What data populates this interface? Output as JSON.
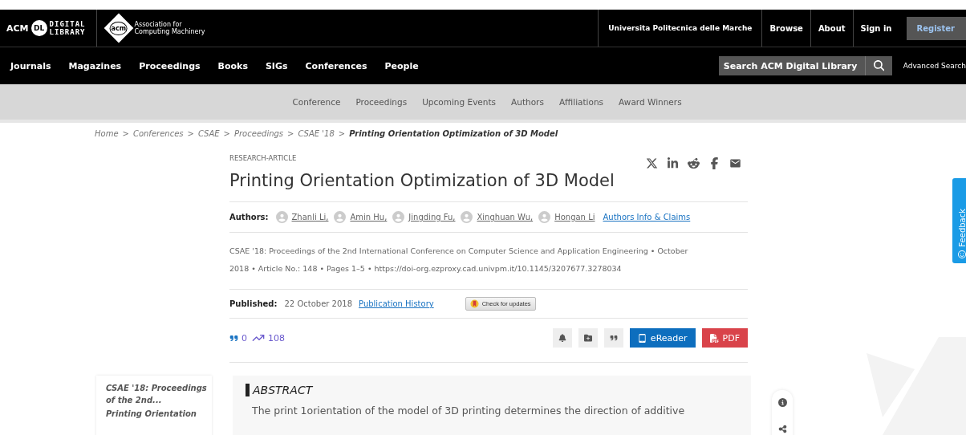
{
  "header": {
    "logo": {
      "acm": "ACM",
      "dl": "DL",
      "line1": "DIGITAL",
      "line2": "LIBRARY"
    },
    "org_logo": {
      "mark": "acm",
      "line1": "Association for",
      "line2": "Computing Machinery"
    },
    "institution": "Universita Politecnica delle Marche",
    "links": [
      "Browse",
      "About",
      "Sign in"
    ],
    "register": "Register"
  },
  "nav": {
    "items": [
      "Journals",
      "Magazines",
      "Proceedings",
      "Books",
      "SIGs",
      "Conferences",
      "People"
    ],
    "search": {
      "placeholder": "Search ACM Digital Library"
    },
    "advanced": "Advanced Search"
  },
  "subnav": [
    "Conference",
    "Proceedings",
    "Upcoming Events",
    "Authors",
    "Affiliations",
    "Award Winners"
  ],
  "breadcrumb": {
    "separator": ">",
    "items": [
      "Home",
      "Conferences",
      "CSAE",
      "Proceedings",
      "CSAE '18",
      "Printing Orientation Optimization of 3D Model"
    ]
  },
  "article": {
    "type": "RESEARCH-ARTICLE",
    "title": "Printing Orientation Optimization of 3D Model",
    "authors_label": "Authors:",
    "authors": [
      "Zhanli Li,",
      "Amin Hu,",
      "Jingding Fu,",
      "Xinghuan Wu,",
      "Hongan Li"
    ],
    "authors_info": "Authors Info & Claims",
    "citation": "CSAE '18: Proceedings of the 2nd International Conference on Computer Science and Application Engineering • October 2018 • Article No.: 148 • Pages 1–5 • https://doi-org.ezproxy.cad.univpm.it/10.1145/3207677.3278034",
    "published_label": "Published:",
    "published_date": "22 October 2018",
    "history": "Publication History",
    "updates": "Check for updates",
    "citations": "0",
    "downloads": "108",
    "ereader": "eReader",
    "pdf": "PDF"
  },
  "abstract": {
    "heading": "ABSTRACT",
    "text": "The print 1orientation of the model of 3D printing determines the direction of additive"
  },
  "sidebar": {
    "proceedings": "CSAE '18: Proceedings of the 2nd...",
    "article": "Printing Orientation"
  },
  "feedback": "Feedback"
}
